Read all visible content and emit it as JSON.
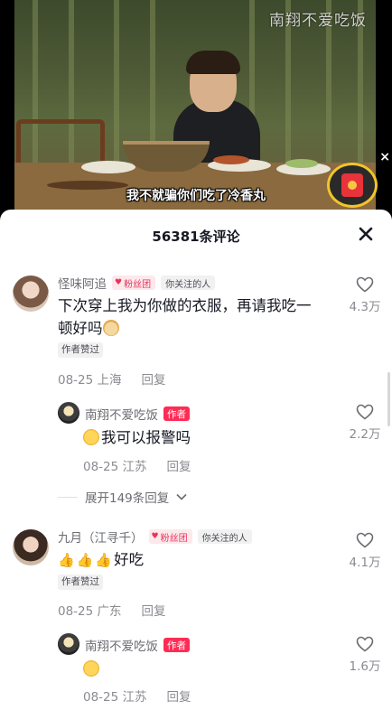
{
  "video": {
    "watermark": "南翔不爱吃饭",
    "subtitle": "我不就骗你们吃了冷香丸",
    "close_symbol": "×",
    "redpacket_icon": "red-envelope-icon"
  },
  "sheet": {
    "title": "56381条评论",
    "close_icon": "close-icon"
  },
  "comments": [
    {
      "user": "怪味阿追",
      "fan_badge": "粉丝团",
      "follow_badge": "你关注的人",
      "text_line1": "下次穿上我为你做的衣服，再请我吃一",
      "text_line2": "顿好吗",
      "emoji": "dog-face-emoji",
      "author_liked": "作者赞过",
      "date": "08-25",
      "location": "上海",
      "reply_label": "回复",
      "likes": "4.3万",
      "replies": [
        {
          "user": "南翔不爱吃饭",
          "author_badge": "作者",
          "text": "我可以报警吗",
          "emoji": "shy-face-emoji",
          "date": "08-25",
          "location": "江苏",
          "reply_label": "回复",
          "likes": "2.2万"
        }
      ],
      "expand_label": "展开149条回复"
    },
    {
      "user": "九月（江寻千）",
      "fan_badge": "粉丝团",
      "follow_badge": "你关注的人",
      "text": "好吃",
      "emoji": "thumbs-up-emoji",
      "author_liked": "作者赞过",
      "date": "08-25",
      "location": "广东",
      "reply_label": "回复",
      "likes": "4.1万",
      "replies": [
        {
          "user": "南翔不爱吃饭",
          "author_badge": "作者",
          "emoji": "pleading-face-emoji",
          "date": "08-25",
          "location": "江苏",
          "reply_label": "回复",
          "likes": "1.6万"
        }
      ]
    }
  ],
  "colors": {
    "accent": "#fe2c55",
    "fan_badge_bg": "#fde8ec",
    "text_primary": "#161823",
    "text_secondary": "#8a8b91",
    "redpacket_ring": "#f2c42c"
  }
}
